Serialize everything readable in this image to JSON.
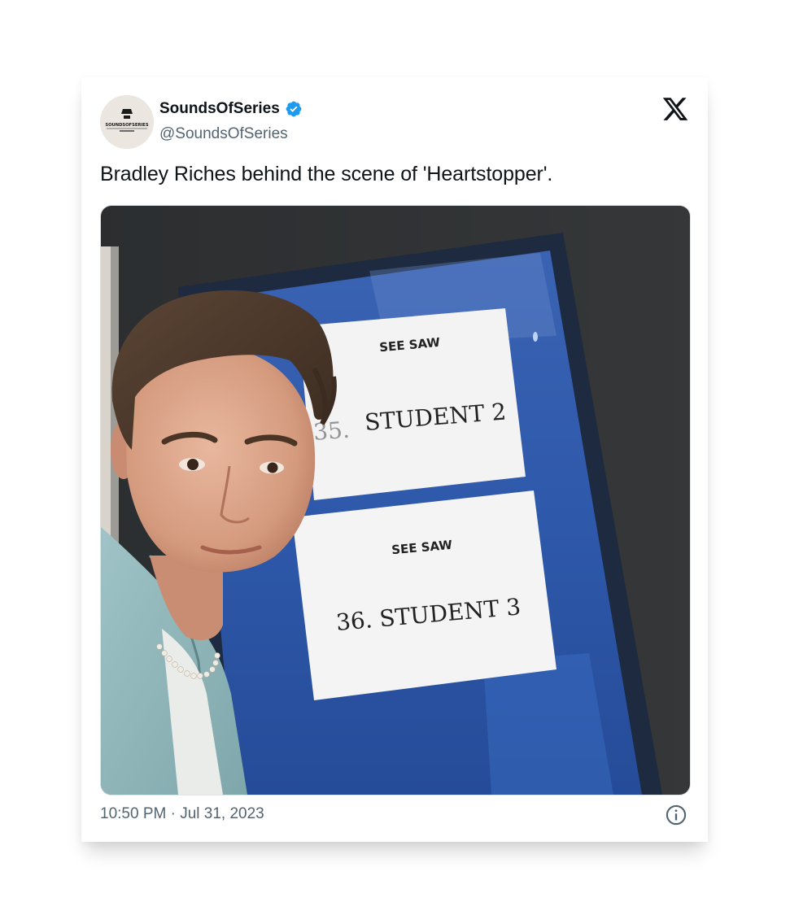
{
  "tweet": {
    "display_name": "SoundsOfSeries",
    "handle": "@SoundsOfSeries",
    "verified": true,
    "avatar_text": "SOUNDSOFSERIES",
    "text": "Bradley Riches behind the scene of 'Heartstopper'.",
    "timestamp": "10:50 PM · Jul 31, 2023"
  },
  "media": {
    "sign_top_brand": "SEE SAW",
    "sign_top_label": "35. STUDENT 2",
    "sign_top_visible": "STUDENT 2",
    "sign_top_partial": "35.",
    "sign_bottom_brand": "SEE SAW",
    "sign_bottom_label": "36. STUDENT 3"
  },
  "icons": {
    "verified": "verified-badge-icon",
    "platform": "x-logo-icon",
    "info": "info-icon"
  },
  "colors": {
    "verified_blue": "#1d9bf0",
    "text_primary": "#0f1419",
    "text_secondary": "#536471"
  }
}
